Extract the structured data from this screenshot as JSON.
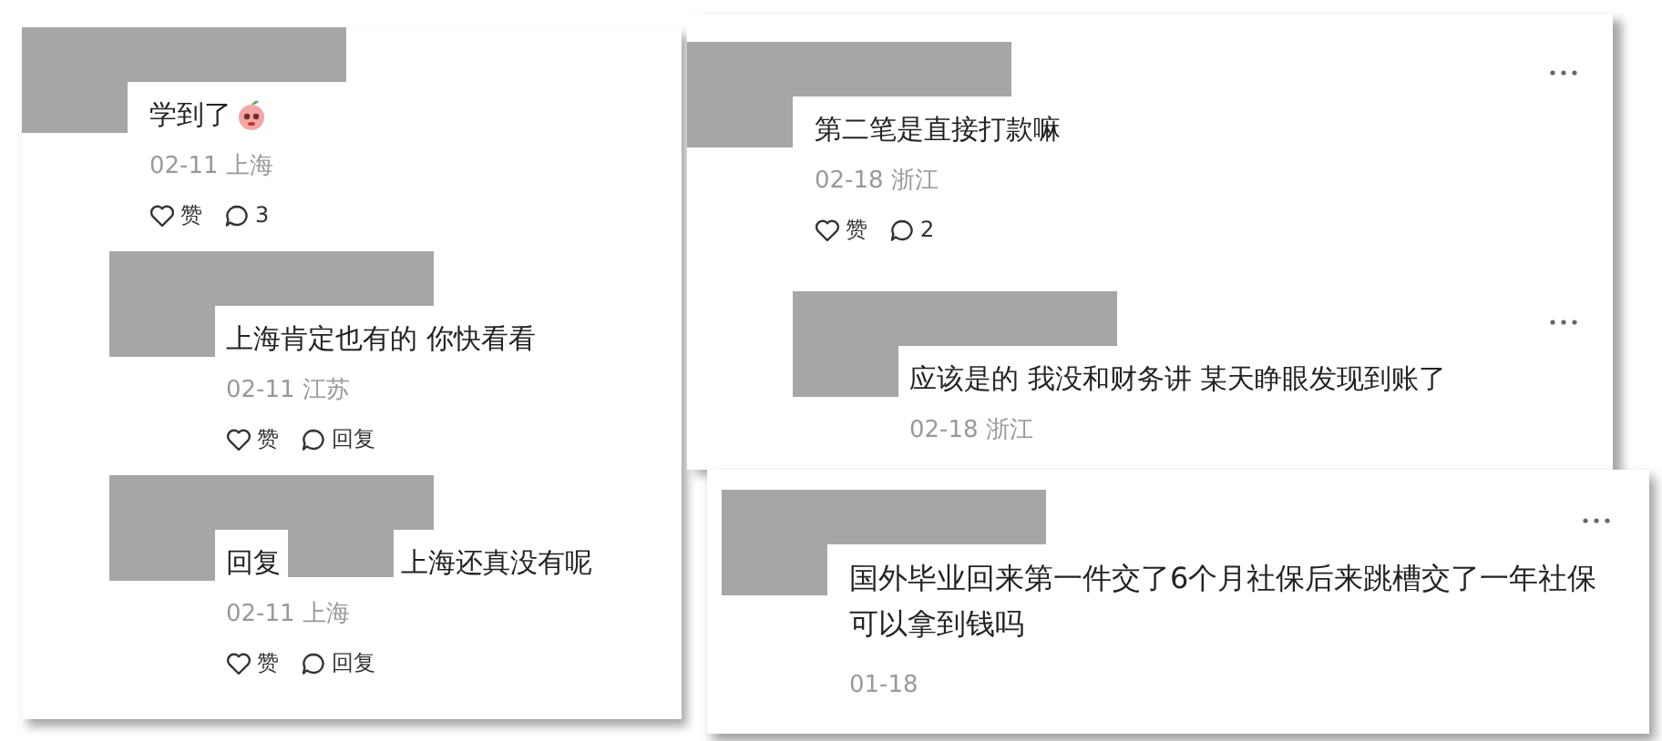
{
  "panels": [
    {
      "comments": [
        {
          "text": "学到了",
          "sticker": true,
          "meta": "02-11 上海",
          "actions": {
            "like": "赞",
            "reply": "3"
          },
          "children": [
            {
              "text": "上海肯定也有的 你快看看",
              "meta": "02-11 江苏",
              "actions": {
                "like": "赞",
                "reply": "回复"
              }
            },
            {
              "reply_prefix": "回复",
              "text": "上海还真没有呢",
              "meta": "02-11 上海",
              "actions": {
                "like": "赞",
                "reply": "回复"
              }
            }
          ]
        }
      ]
    },
    {
      "comments": [
        {
          "text": "第二笔是直接打款嘛",
          "menu": true,
          "meta": "02-18 浙江",
          "actions": {
            "like": "赞",
            "reply": "2"
          },
          "children": [
            {
              "text": "应该是的 我没和财务讲 某天睁眼发现到账了",
              "menu": true,
              "meta": "02-18 浙江"
            }
          ]
        }
      ]
    },
    {
      "comments": [
        {
          "text": "国外毕业回来第一件交了6个月社保后来跳槽交了一年社保可以拿到钱吗",
          "menu": true,
          "meta": "01-18"
        }
      ]
    }
  ]
}
